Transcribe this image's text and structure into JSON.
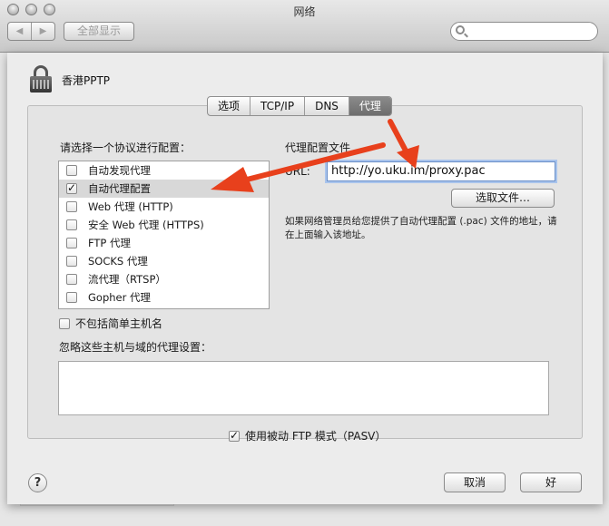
{
  "window": {
    "title": "网络",
    "nav_back": "◀",
    "nav_forward": "▶",
    "show_all": "全部显示"
  },
  "vpn": {
    "name": "香港PPTP"
  },
  "tabs": [
    {
      "label": "选项",
      "active": false
    },
    {
      "label": "TCP/IP",
      "active": false
    },
    {
      "label": "DNS",
      "active": false
    },
    {
      "label": "代理",
      "active": true
    }
  ],
  "protocols": {
    "prompt": "请选择一个协议进行配置：",
    "items": [
      {
        "label": "自动发现代理",
        "checked": false,
        "selected": false
      },
      {
        "label": "自动代理配置",
        "checked": true,
        "selected": true
      },
      {
        "label": "Web 代理 (HTTP)",
        "checked": false,
        "selected": false
      },
      {
        "label": "安全 Web 代理 (HTTPS)",
        "checked": false,
        "selected": false
      },
      {
        "label": "FTP 代理",
        "checked": false,
        "selected": false
      },
      {
        "label": "SOCKS 代理",
        "checked": false,
        "selected": false
      },
      {
        "label": "流代理（RTSP）",
        "checked": false,
        "selected": false
      },
      {
        "label": "Gopher 代理",
        "checked": false,
        "selected": false
      }
    ]
  },
  "exclude_simple": {
    "label": "不包括简单主机名",
    "checked": false
  },
  "bypass": {
    "label": "忽略这些主机与域的代理设置：",
    "value": ""
  },
  "proxy_config": {
    "section_label": "代理配置文件",
    "url_label": "URL:",
    "url_value": "http://yo.uku.im/proxy.pac",
    "choose_file": "选取文件…",
    "help": "如果网络管理员给您提供了自动代理配置 (.pac) 文件的地址，请在上面输入该地址。"
  },
  "pasv": {
    "label": "使用被动 FTP 模式（PASV）",
    "checked": true
  },
  "footer": {
    "help": "?",
    "cancel": "取消",
    "ok": "好"
  },
  "colors": {
    "arrow": "#e8401c",
    "tab_active": "#7a7a7a",
    "focus_ring": "#a9c4ec"
  }
}
